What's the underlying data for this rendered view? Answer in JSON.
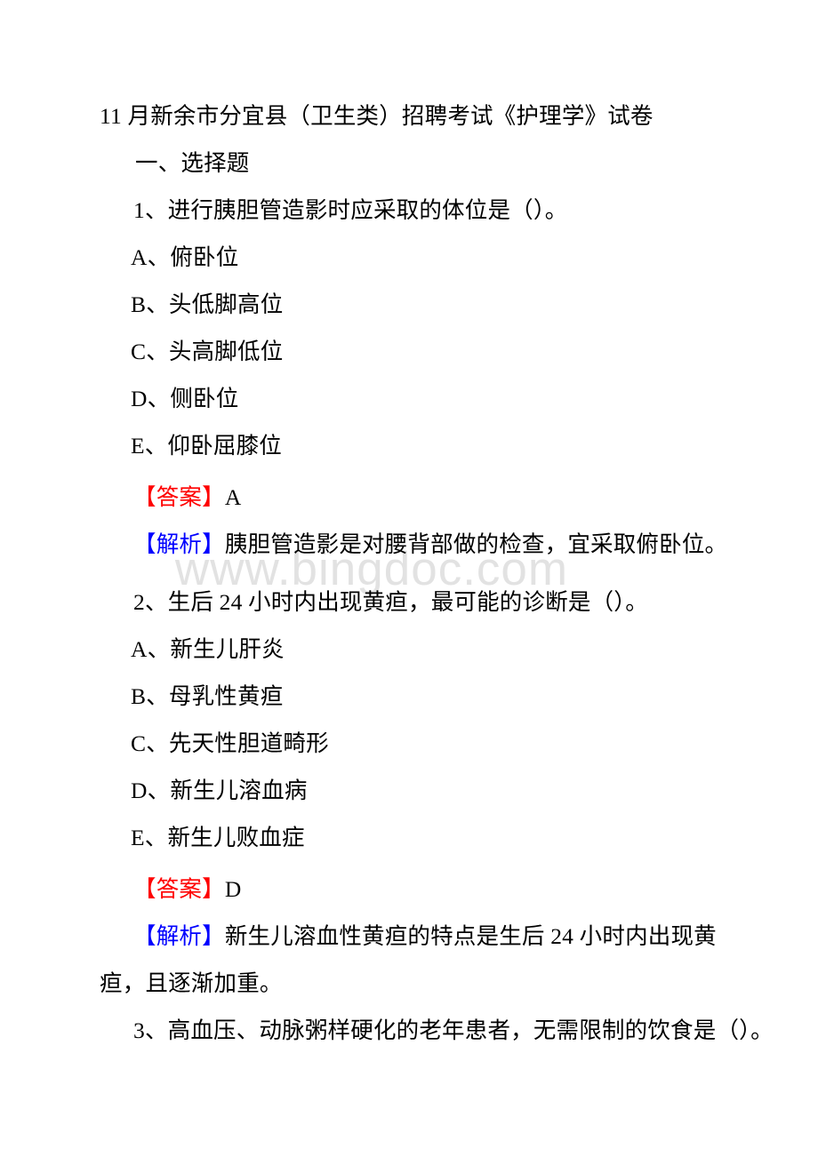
{
  "document": {
    "title": "11 月新余市分宜县（卫生类）招聘考试《护理学》试卷",
    "watermark": "www.bingdoc.com",
    "section_heading": "一、选择题",
    "label_answer": "【答案】",
    "label_explanation": "【解析】",
    "colors": {
      "answer_tag": "#ff0000",
      "explanation_tag": "#0000ff",
      "body_text": "#000000",
      "watermark": "#e2e2e2",
      "page_background": "#ffffff"
    }
  },
  "questions": [
    {
      "number": "1、",
      "stem": "进行胰胆管造影时应采取的体位是（）。",
      "options": [
        "A、俯卧位",
        "B、头低脚高位",
        "C、头高脚低位",
        "D、侧卧位",
        "E、仰卧屈膝位"
      ],
      "answer": "A",
      "explanation": "胰胆管造影是对腰背部做的检查，宜采取俯卧位。"
    },
    {
      "number": "2、",
      "stem": "生后 24 小时内出现黄疸，最可能的诊断是（）。",
      "options": [
        "A、新生儿肝炎",
        "B、母乳性黄疸",
        "C、先天性胆道畸形",
        "D、新生儿溶血病",
        "E、新生儿败血症"
      ],
      "answer": "D",
      "explanation": "新生儿溶血性黄疸的特点是生后 24 小时内出现黄疸，且逐渐加重。"
    },
    {
      "number": "3、",
      "stem": "高血压、动脉粥样硬化的老年患者，无需限制的饮食是（）。",
      "options": [],
      "answer": "",
      "explanation": ""
    }
  ]
}
